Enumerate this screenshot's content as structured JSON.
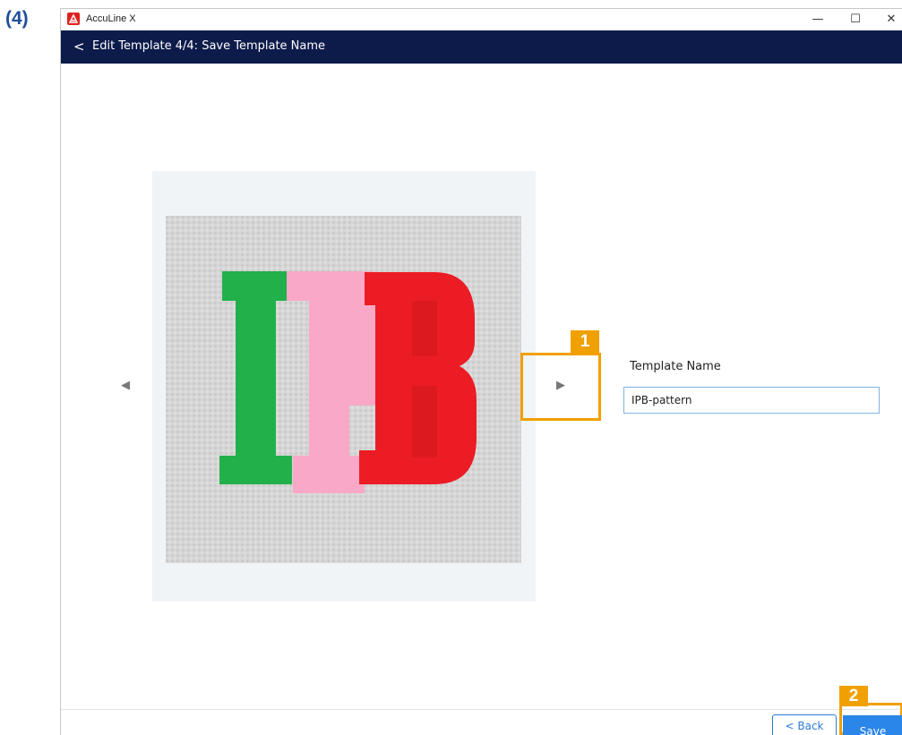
{
  "step_label": "(4)",
  "window": {
    "app_title": "AccuLine X",
    "controls": {
      "minimize": "—",
      "maximize": "☐",
      "close": "✕"
    }
  },
  "header": {
    "back_glyph": "<",
    "title": "Edit Template 4/4: Save Template Name"
  },
  "preview": {
    "prev_arrow": "◀",
    "next_arrow": "▶",
    "image_description_icon": "template-preview-image"
  },
  "form": {
    "label": "Template Name",
    "value": "IPB-pattern"
  },
  "callouts": {
    "one": "1",
    "two": "2"
  },
  "footer": {
    "back_label": "< Back",
    "save_label": "Save"
  },
  "colors": {
    "header_bg": "#0d1b4b",
    "accent": "#2a86e8",
    "highlight": "#f0a000",
    "panel_bg": "#f1f4f7"
  }
}
